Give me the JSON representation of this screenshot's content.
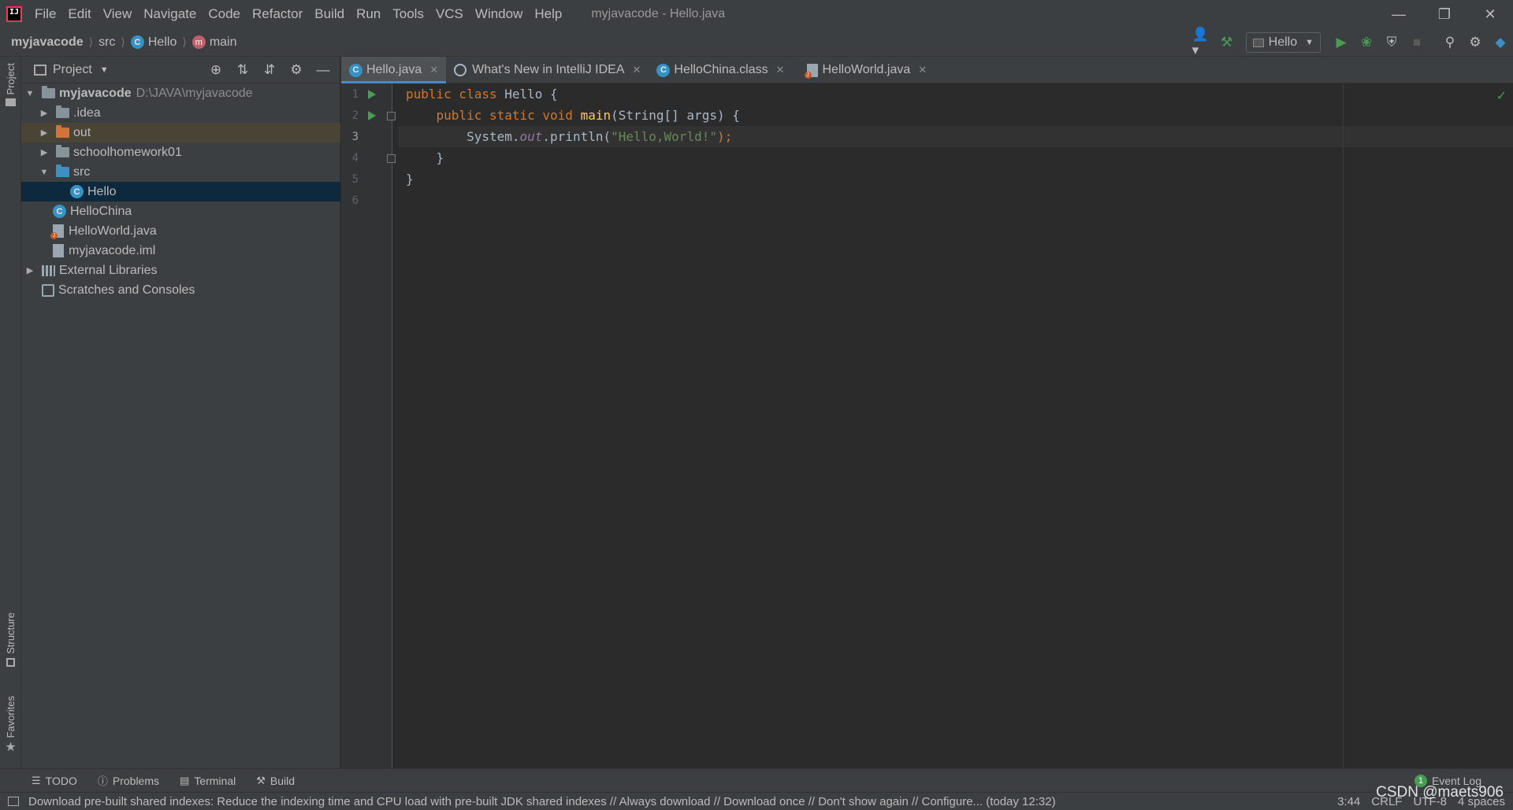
{
  "menu": [
    "File",
    "Edit",
    "View",
    "Navigate",
    "Code",
    "Refactor",
    "Build",
    "Run",
    "Tools",
    "VCS",
    "Window",
    "Help"
  ],
  "window_title": "myjavacode - Hello.java",
  "breadcrumb": {
    "project": "myjavacode",
    "folder": "src",
    "cls": "Hello",
    "method": "main"
  },
  "run_config": "Hello",
  "left_strip": {
    "project": "Project",
    "structure": "Structure",
    "favorites": "Favorites"
  },
  "project_panel": {
    "title": "Project"
  },
  "tree": {
    "root": "myjavacode",
    "root_path": "D:\\JAVA\\myjavacode",
    "idea": ".idea",
    "out": "out",
    "school": "schoolhomework01",
    "src": "src",
    "hello": "Hello",
    "hellochina": "HelloChina",
    "helloworld": "HelloWorld.java",
    "iml": "myjavacode.iml",
    "external": "External Libraries",
    "scratches": "Scratches and Consoles"
  },
  "tabs": {
    "t1": "Hello.java",
    "t2": "What's New in IntelliJ IDEA",
    "t3": "HelloChina.class",
    "t4": "HelloWorld.java"
  },
  "code": {
    "l1_kw": "public class ",
    "l1_name": "Hello {",
    "l2_kw": "    public static void ",
    "l2_fn": "main",
    "l2_rest": "(String[] args) {",
    "l3_a": "        System.",
    "l3_field": "out",
    "l3_b": ".println(",
    "l3_str": "\"Hello,World!\"",
    "l3_c": ");",
    "l4": "    }",
    "l5": "}",
    "l6": ""
  },
  "line_numbers": [
    "1",
    "2",
    "3",
    "4",
    "5",
    "6"
  ],
  "bottom_tools": {
    "todo": "TODO",
    "problems": "Problems",
    "terminal": "Terminal",
    "build": "Build",
    "event_log": "Event Log",
    "event_count": "1"
  },
  "status": {
    "message": "Download pre-built shared indexes: Reduce the indexing time and CPU load with pre-built JDK shared indexes // Always download // Download once // Don't show again // Configure... (today 12:32)",
    "position": "3:44",
    "line_sep": "CRLF",
    "encoding": "UTF-8",
    "indent": "4 spaces"
  },
  "watermark": "CSDN @maets906",
  "colors": {
    "accent": "#4a88c7",
    "run": "#499c54",
    "keyword": "#cc7832",
    "string": "#6a8759"
  }
}
